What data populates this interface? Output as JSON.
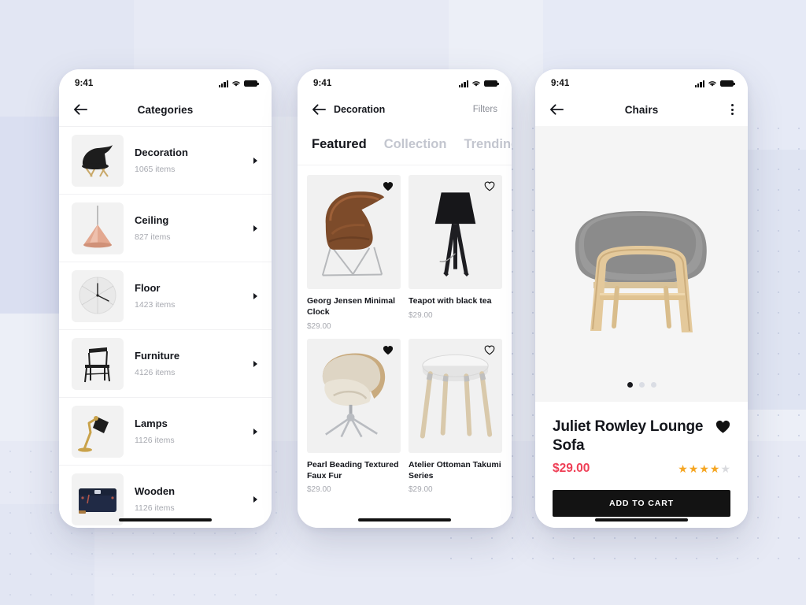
{
  "background": {
    "base_color": "#eceff7",
    "block_color": "#dfe3f0",
    "dot_color": "#b9c1da"
  },
  "status_bar": {
    "time": "9:41",
    "signal_icon": "cellular-signal-icon",
    "wifi_icon": "wifi-icon",
    "battery_icon": "battery-full-icon"
  },
  "phone1": {
    "nav": {
      "back_icon": "back-arrow-icon",
      "title": "Categories"
    },
    "categories": [
      {
        "name": "Decoration",
        "count": "1065 items",
        "thumb": "black-eames-chair"
      },
      {
        "name": "Ceiling",
        "count": "827 items",
        "thumb": "copper-pendant-lamp"
      },
      {
        "name": "Floor",
        "count": "1423 items",
        "thumb": "white-wall-clock"
      },
      {
        "name": "Furniture",
        "count": "4126 items",
        "thumb": "black-dining-chair"
      },
      {
        "name": "Lamps",
        "count": "1126 items",
        "thumb": "brass-desk-lamp"
      },
      {
        "name": "Wooden",
        "count": "1126 items",
        "thumb": "navy-laptop-case"
      }
    ],
    "caret_icon": "chevron-right-icon"
  },
  "phone2": {
    "nav": {
      "back_icon": "back-arrow-icon",
      "title": "Decoration",
      "filters_label": "Filters"
    },
    "tabs": [
      {
        "label": "Featured",
        "active": true
      },
      {
        "label": "Collection",
        "active": false
      },
      {
        "label": "Trending",
        "active": false
      }
    ],
    "products": [
      {
        "title": "Georg Jensen Minimal Clock",
        "price": "$29.00",
        "favorited": true,
        "image": "walnut-shell-chair"
      },
      {
        "title": "Teapot with black tea",
        "price": "$29.00",
        "favorited": false,
        "image": "black-tripod-floor-lamp"
      },
      {
        "title": "Pearl Beading Textured Faux Fur",
        "price": "$29.00",
        "favorited": true,
        "image": "cream-swivel-armchair"
      },
      {
        "title": "Atelier Ottoman Takumi Series",
        "price": "$29.00",
        "favorited": false,
        "image": "white-round-side-table"
      }
    ],
    "favorite_icon": "heart-icon"
  },
  "phone3": {
    "nav": {
      "back_icon": "back-arrow-icon",
      "title": "Chairs",
      "menu_icon": "more-vertical-icon"
    },
    "hero": {
      "image": "grey-upholstered-wood-ottoman",
      "carousel_dots": 3,
      "active_dot": 1
    },
    "product": {
      "title": "Juliet Rowley Lounge Sofa",
      "price": "$29.00",
      "price_color": "#ef3f56",
      "favorite_icon": "heart-filled-icon",
      "favorited": true,
      "rating": 4,
      "rating_max": 5,
      "star_color": "#f5a623",
      "star_empty_color": "#d9dade",
      "add_to_cart_label": "ADD TO CART"
    }
  }
}
